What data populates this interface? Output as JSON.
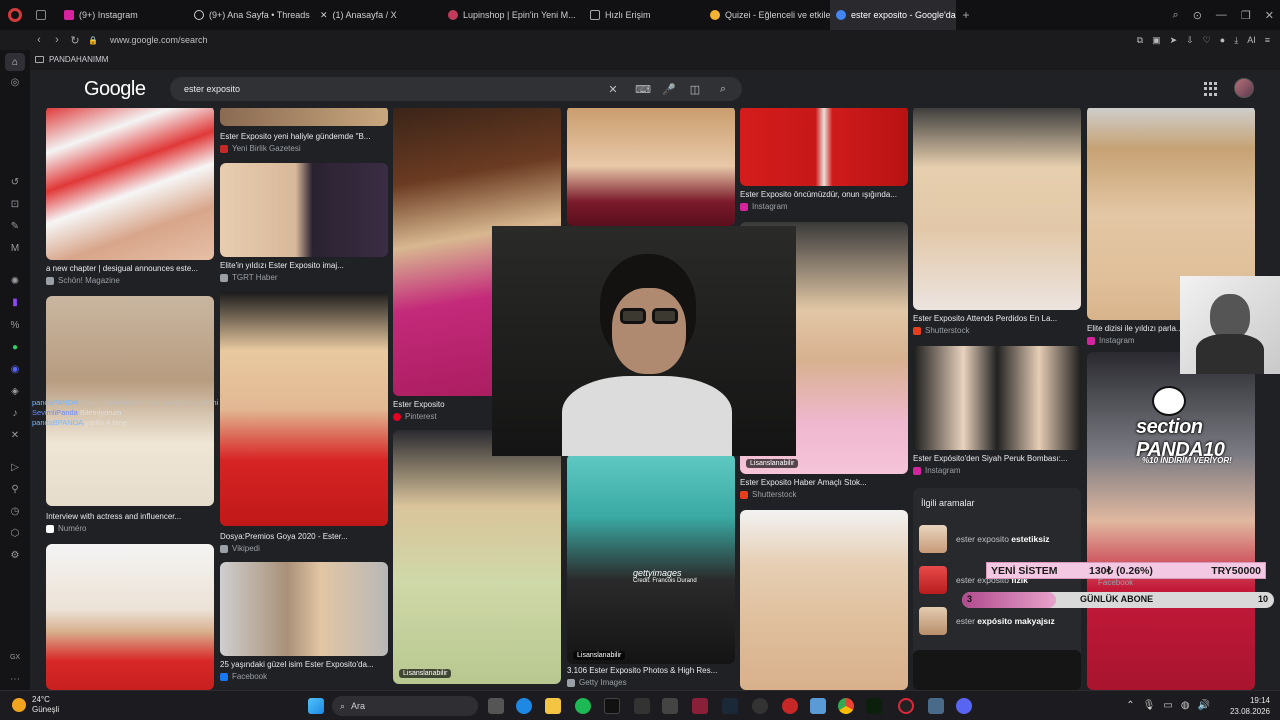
{
  "browser": {
    "tabs": [
      {
        "label": "(9+) Instagram",
        "color": "#d6249f"
      },
      {
        "label": "(9+) Ana Sayfa • Threads",
        "color": "#cfcfcf"
      },
      {
        "label": "(1) Anasayfa / X",
        "color": "#cfcfcf"
      },
      {
        "label": "Lupinshop | Epin'in Yeni M...",
        "color": "#c23b5a"
      },
      {
        "label": "Hızlı Erişim",
        "color": "#6c6cff"
      },
      {
        "label": "Quizei - Eğlenceli ve etkile...",
        "color": "#f2b233"
      },
      {
        "label": "ester exposito - Google'da ...",
        "color": "#4285f4"
      }
    ],
    "url": "www.google.com/search",
    "bookmark_folder": "PANDAHANIMM"
  },
  "google": {
    "logo": "Google",
    "query": "ester exposito"
  },
  "results": [
    {
      "caption": "a new chapter | desigual announces este...",
      "source": "Schön! Magazine",
      "fav": "#9aa0a6"
    },
    {
      "caption": "Interview with actress and influencer...",
      "source": "Numéro",
      "fav": "#ffffff"
    },
    {
      "caption": "Ester Exposito yeni haliyle gündemde \"B...",
      "source": "Yeni Birlik Gazetesi",
      "fav": "#c62828"
    },
    {
      "caption": "Elite'in yıldızı Ester Exposito imaj...",
      "source": "TGRT Haber",
      "fav": "#9aa0a6"
    },
    {
      "caption": "Dosya:Premios Goya 2020 - Ester...",
      "source": "Vikipedi",
      "fav": "#9aa0a6"
    },
    {
      "caption": "25 yaşındaki güzel isim Ester Exposito'da...",
      "source": "Facebook",
      "fav": "#1877f2"
    },
    {
      "caption": "Ester Exposito",
      "source": "Pinterest",
      "fav": "#e60023"
    },
    {
      "caption": "3.106 Ester Exposito Photos & High Res...",
      "source": "Getty Images",
      "fav": "#9aa0a6"
    },
    {
      "caption": "Ester Exposito öncümüzdür, onun ışığında...",
      "source": "Instagram",
      "fav": "#d6249f"
    },
    {
      "caption": "Ester Exposito Haber Amaçlı Stok...",
      "source": "Shutterstock",
      "fav": "#e83e1b"
    },
    {
      "caption": "Ester Exposito Attends Perdidos En La...",
      "source": "Shutterstock",
      "fav": "#e83e1b"
    },
    {
      "caption": "Ester Expósito'den Siyah Peruk Bombası:...",
      "source": "Instagram",
      "fav": "#d6249f"
    },
    {
      "caption": "Elite dizisi ile yıldızı parla...",
      "source": "Instagram",
      "fav": "#d6249f"
    }
  ],
  "licensed_label": "Lisanslanabilir",
  "getty_watermark": "gettyimages",
  "getty_credit": "Credit: Francois Durand",
  "related": {
    "title": "İlgili aramalar",
    "items": [
      {
        "prefix": "ester exposito ",
        "bold": "estetiksiz"
      },
      {
        "prefix": "ester exposito ",
        "bold": "fizik"
      },
      {
        "prefix": "ester ",
        "bold": "expósito makyajsız"
      }
    ],
    "partial_source": "Facebook"
  },
  "overlay": {
    "chat": [
      {
        "user": "pandaPANDA",
        "text": "2 tane daha bende mak için eposta istemi",
        "color": "#7ab8ff"
      },
      {
        "user": "SevimliPanda",
        "text": "Bilemiyorum",
        "color": "#6b8cff"
      },
      {
        "user": "pandaBPANDA",
        "text": "yanlis 4 tane",
        "color": "#7ab8ff"
      }
    ],
    "badge_title": "section PANDA10",
    "badge_sub": "%10 İNDİRİM VERİYOR!",
    "ticker": {
      "label": "YENİ SİSTEM",
      "value": "130₺ (0.26%)",
      "goal": "TRY50000"
    },
    "subs": {
      "current": "3",
      "label": "GÜNLÜK ABONE",
      "goal": "10",
      "fraction": 0.3
    }
  },
  "taskbar": {
    "temp": "24°C",
    "weather": "Güneşli",
    "search": "Ara",
    "time": "19:14",
    "date": "23.08.2026"
  }
}
